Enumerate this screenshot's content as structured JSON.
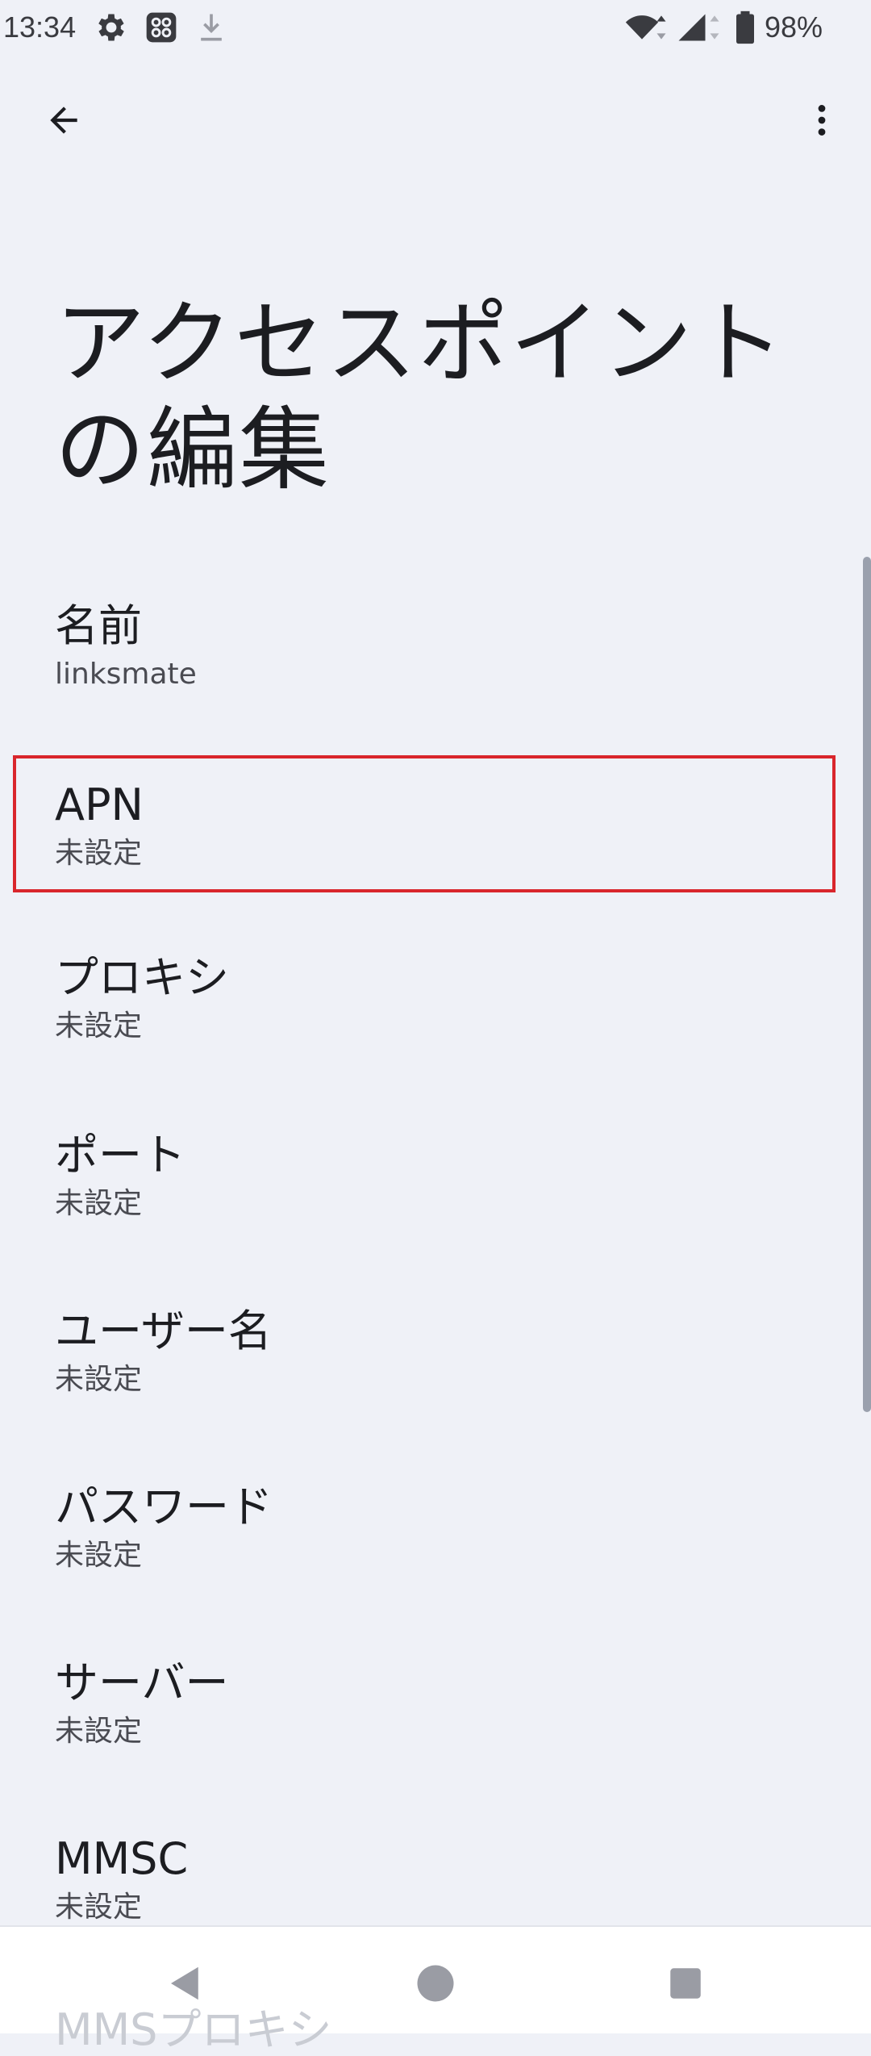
{
  "status_bar": {
    "time": "13:34",
    "battery": "98%",
    "icons": [
      "gear-icon",
      "app-grid-icon",
      "download-icon",
      "wifi-icon",
      "signal-icon",
      "battery-icon"
    ]
  },
  "toolbar": {
    "back_icon": "arrow-left-icon",
    "menu_icon": "more-vert-icon"
  },
  "page": {
    "title": "アクセスポイントの編集"
  },
  "settings": [
    {
      "label": "名前",
      "value": "linksmate",
      "highlighted": false
    },
    {
      "label": "APN",
      "value": "未設定",
      "highlighted": true
    },
    {
      "label": "プロキシ",
      "value": "未設定",
      "highlighted": false
    },
    {
      "label": "ポート",
      "value": "未設定",
      "highlighted": false
    },
    {
      "label": "ユーザー名",
      "value": "未設定",
      "highlighted": false
    },
    {
      "label": "パスワード",
      "value": "未設定",
      "highlighted": false
    },
    {
      "label": "サーバー",
      "value": "未設定",
      "highlighted": false
    },
    {
      "label": "MMSC",
      "value": "未設定",
      "highlighted": false
    }
  ],
  "cutoff_item": {
    "label": "MMSプロキシ"
  },
  "colors": {
    "background": "#eff1f7",
    "highlight_border": "#d9262c",
    "text_primary": "#1c1d21",
    "text_secondary": "#4a4b52"
  },
  "nav": {
    "back": "nav-back-icon",
    "home": "nav-home-icon",
    "recents": "nav-recents-icon"
  }
}
